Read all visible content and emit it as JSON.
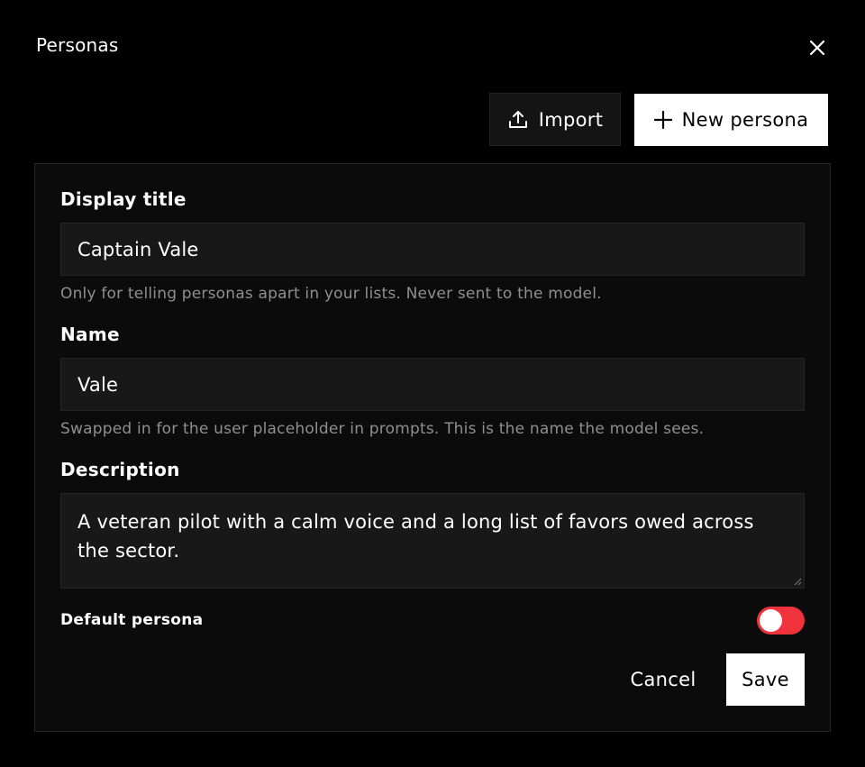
{
  "dialog": {
    "title": "Personas",
    "close_icon": "close-icon"
  },
  "toolbar": {
    "import_label": "Import",
    "import_icon": "upload-icon",
    "new_label": "New persona",
    "new_icon": "plus-icon"
  },
  "form": {
    "display_title": {
      "label": "Display title",
      "value": "Captain Vale",
      "hint": "Only for telling personas apart in your lists. Never sent to the model."
    },
    "name": {
      "label": "Name",
      "value": "Vale",
      "hint": "Swapped in for the user placeholder in prompts. This is the name the model sees."
    },
    "description": {
      "label": "Description",
      "value": "A veteran pilot with a calm voice and a long list of favors owed across the sector."
    },
    "default_persona": {
      "label": "Default persona",
      "enabled": false
    }
  },
  "actions": {
    "cancel_label": "Cancel",
    "save_label": "Save"
  },
  "colors": {
    "background": "#000000",
    "panel": "#0b0b0b",
    "input": "#181818",
    "accent_toggle": "#f0323c",
    "hint_text": "#8f8f8f",
    "primary_button": "#ffffff"
  }
}
